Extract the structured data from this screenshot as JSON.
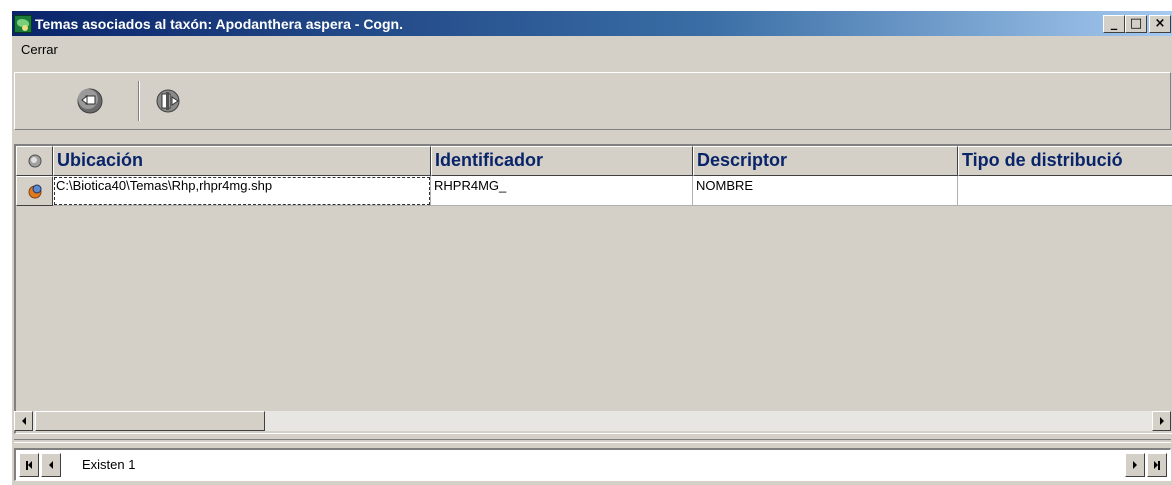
{
  "window": {
    "title": "Temas asociados al taxón: Apodanthera aspera - Cogn.",
    "controls": {
      "minimize": "_",
      "maximize": "□",
      "close": "×"
    }
  },
  "menu": {
    "items": [
      "Cerrar"
    ]
  },
  "toolbar": {
    "buttons": [
      {
        "icon": "back-arrow-icon"
      },
      {
        "icon": "export-icon"
      }
    ]
  },
  "grid": {
    "columns": [
      "Ubicación",
      "Identificador",
      "Descriptor",
      "Tipo de distribució"
    ],
    "rows": [
      {
        "ubicacion": "C:\\Biotica40\\Temas\\Rhp,rhpr4mg.shp",
        "identificador": "RHPR4MG_",
        "descriptor": "NOMBRE",
        "tipo_distribucion": ""
      }
    ]
  },
  "navigator": {
    "status": "Existen 1"
  },
  "colors": {
    "titlebar_start": "#0a246a",
    "titlebar_end": "#a6caf0",
    "header_text": "#0a246a",
    "face": "#d4d0c8"
  }
}
